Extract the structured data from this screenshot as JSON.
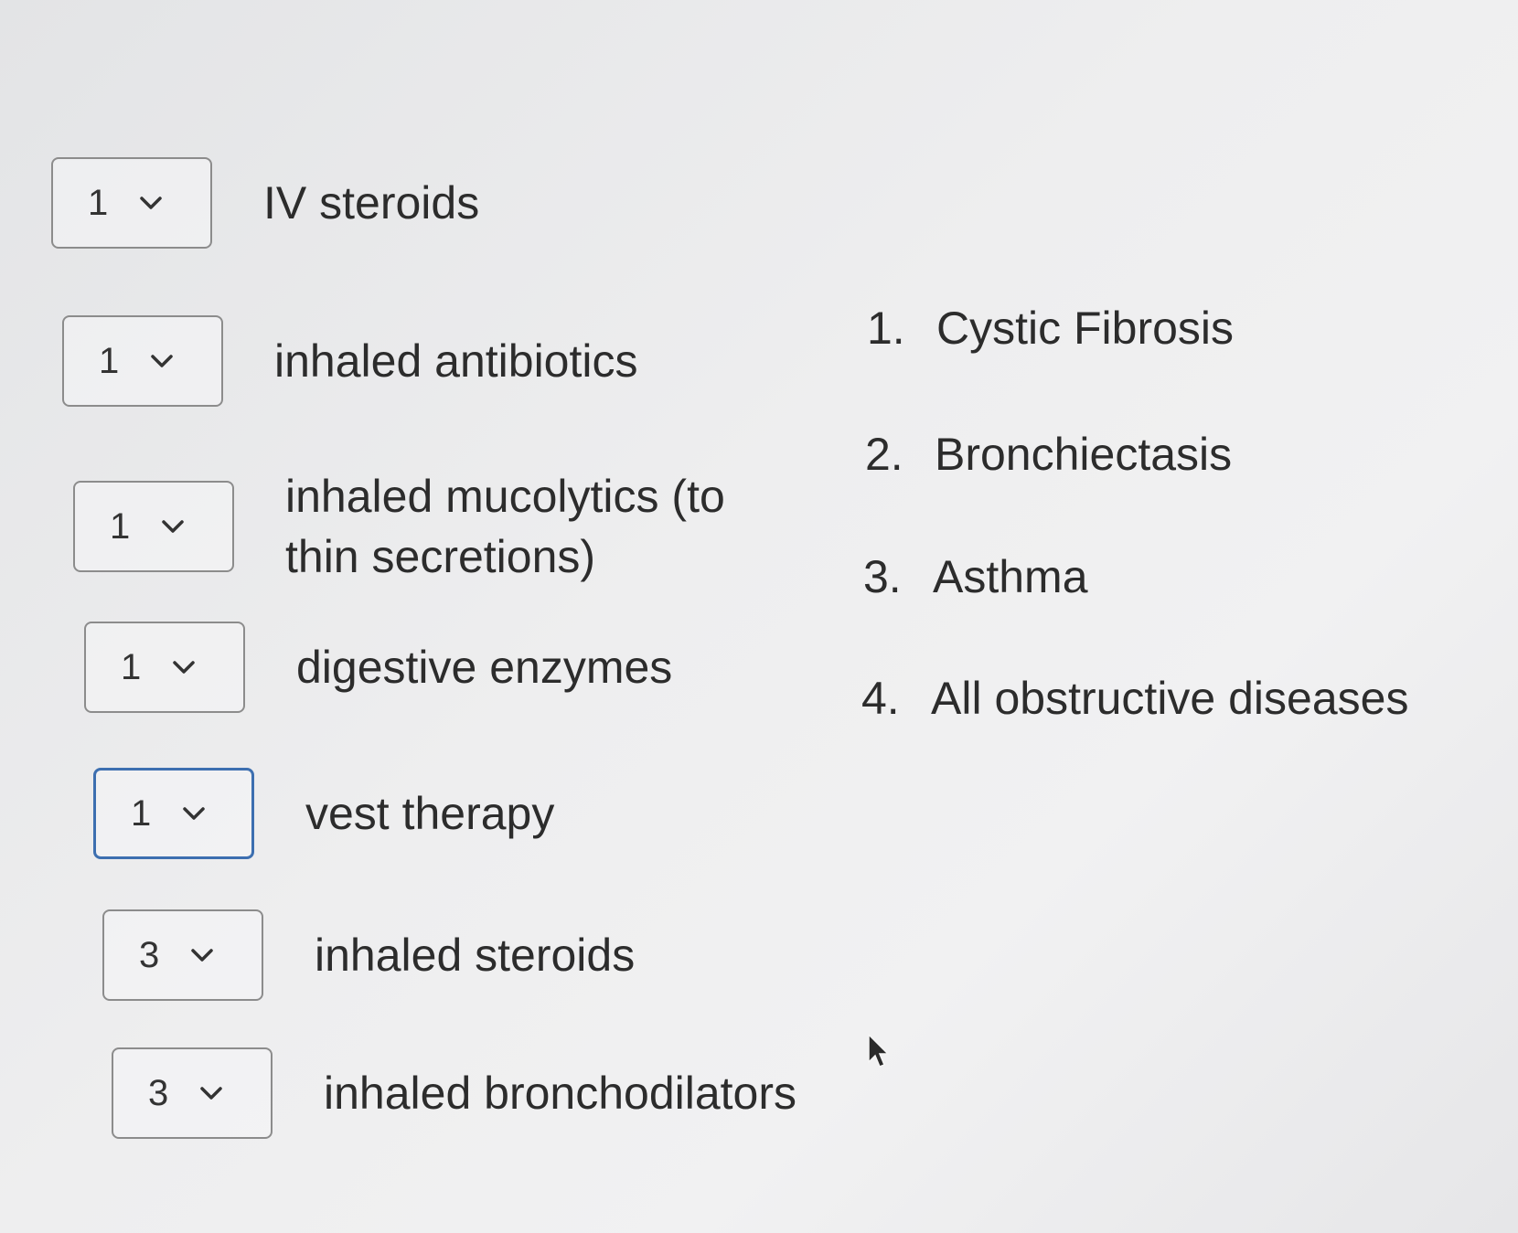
{
  "matching": {
    "items": [
      {
        "value": "1",
        "label": "IV steroids"
      },
      {
        "value": "1",
        "label": "inhaled antibiotics"
      },
      {
        "value": "1",
        "label": "inhaled mucolytics (to thin secretions)"
      },
      {
        "value": "1",
        "label": "digestive enzymes"
      },
      {
        "value": "1",
        "label": "vest therapy"
      },
      {
        "value": "3",
        "label": "inhaled steroids"
      },
      {
        "value": "3",
        "label": "inhaled bronchodilators"
      }
    ]
  },
  "choices": [
    {
      "num": "1.",
      "label": "Cystic Fibrosis"
    },
    {
      "num": "2.",
      "label": "Bronchiectasis"
    },
    {
      "num": "3.",
      "label": "Asthma"
    },
    {
      "num": "4.",
      "label": "All obstructive diseases"
    }
  ],
  "icons": {
    "dropdown": "chevron-down-icon",
    "pointer": "mouse-cursor-icon"
  },
  "colors": {
    "focus_border": "#3d6fb0",
    "default_border": "#8c8c8c"
  }
}
